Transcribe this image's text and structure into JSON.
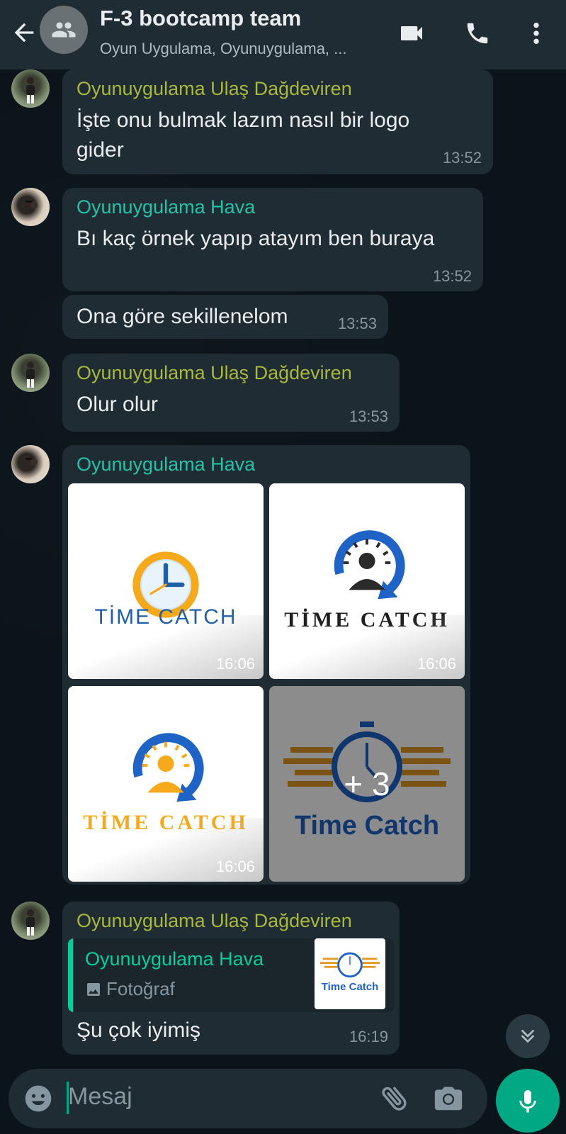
{
  "header": {
    "title": "F-3 bootcamp team",
    "subtitle": "Oyun Uygulama, Oyunuygulama, ..."
  },
  "messages": [
    {
      "sender": "Oyunuygulama Ulaş Dağdeviren",
      "text_line1": "İşte onu bulmak lazım nasıl bir logo",
      "text_line2": "gider",
      "time": "13:52"
    },
    {
      "sender": "Oyunuygulama Hava",
      "text": "Bı kaç örnek yapıp atayım ben buraya",
      "time": "13:52"
    },
    {
      "text": "Ona göre sekillenelom",
      "time": "13:53"
    },
    {
      "sender": "Oyunuygulama Ulaş Dağdeviren",
      "text": "Olur olur",
      "time": "13:53"
    },
    {
      "sender": "Oyunuygulama Hava",
      "photos": [
        {
          "logo_text": "TİME CATCH",
          "time": "16:06"
        },
        {
          "logo_text": "TİME CATCH",
          "time": "16:06"
        },
        {
          "logo_text": "TİME CATCH",
          "time": "16:06"
        },
        {
          "logo_text": "Time Catch",
          "more": "+ 3"
        }
      ]
    },
    {
      "sender": "Oyunuygulama Ulaş Dağdeviren",
      "quote_sender": "Oyunuygulama Hava",
      "quote_type": "Fotoğraf",
      "quote_thumb_text": "Time Catch",
      "text": "Şu çok iyimiş",
      "time": "16:19"
    }
  ],
  "input": {
    "placeholder": "Mesaj"
  },
  "colors": {
    "header_bg": "#1f2c34",
    "chat_bg": "#0b141a",
    "bubble_bg": "#202c33",
    "sender_ulas": "#a8b83b",
    "sender_hava": "#23c3a8",
    "accent": "#00a884"
  },
  "icons": [
    "back-arrow-icon",
    "group-icon",
    "video-call-icon",
    "phone-icon",
    "more-vert-icon",
    "emoji-icon",
    "attach-icon",
    "camera-icon",
    "mic-icon",
    "chevron-down-double-icon",
    "photo-icon"
  ]
}
